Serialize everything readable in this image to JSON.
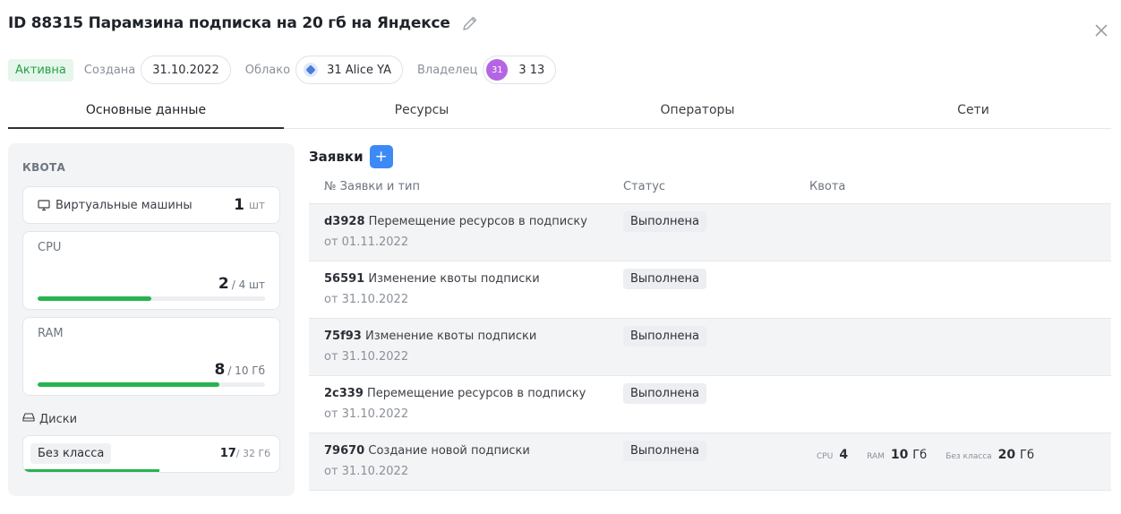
{
  "header": {
    "title": "ID 88315 Парамзина подписка на 20 гб на Яндексе",
    "edit_icon": "pencil-icon",
    "close_icon": "close-icon"
  },
  "meta": {
    "status": "Активна",
    "created_label": "Создана",
    "created_value": "31.10.2022",
    "cloud_label": "Облако",
    "cloud_value": "31 Alice YA",
    "owner_label": "Владелец",
    "owner_avatar": "31",
    "owner_value": "3 13"
  },
  "tabs": [
    {
      "label": "Основные данные",
      "active": true
    },
    {
      "label": "Ресурсы",
      "active": false
    },
    {
      "label": "Операторы",
      "active": false
    },
    {
      "label": "Сети",
      "active": false
    }
  ],
  "quota": {
    "title": "КВОТА",
    "vm": {
      "label": "Виртуальные машины",
      "value": "1",
      "unit": "шт",
      "icon": "monitor-icon"
    },
    "cpu": {
      "label": "CPU",
      "used": "2",
      "total": "/ 4 шт",
      "fraction": 0.5
    },
    "ram": {
      "label": "RAM",
      "used": "8",
      "total": "/ 10 Гб",
      "fraction": 0.8
    },
    "disks": {
      "label": "Диски",
      "icon": "hard-drive-icon",
      "class": "Без класса",
      "used": "17",
      "total": "/ 32 Гб",
      "fraction": 0.53
    }
  },
  "requests": {
    "title": "Заявки",
    "add_label": "+",
    "columns": [
      "№ Заявки и тип",
      "Статус",
      "Квота"
    ],
    "rows": [
      {
        "id": "d3928",
        "type": "Перемещение ресурсов в подписку",
        "date": "от 01.11.2022",
        "status": "Выполнена",
        "quota": null
      },
      {
        "id": "56591",
        "type": "Изменение квоты подписки",
        "date": "от 31.10.2022",
        "status": "Выполнена",
        "quota": null
      },
      {
        "id": "75f93",
        "type": "Изменение квоты подписки",
        "date": "от 31.10.2022",
        "status": "Выполнена",
        "quota": null
      },
      {
        "id": "2c339",
        "type": "Перемещение ресурсов в подписку",
        "date": "от 31.10.2022",
        "status": "Выполнена",
        "quota": null
      },
      {
        "id": "79670",
        "type": "Создание новой подписки",
        "date": "от 31.10.2022",
        "status": "Выполнена",
        "quota": {
          "cpu_label": "CPU",
          "cpu_value": "4",
          "ram_label": "RAM",
          "ram_value": "10",
          "ram_unit": "Гб",
          "disk_label": "Без класса",
          "disk_value": "20",
          "disk_unit": "Гб"
        }
      }
    ]
  },
  "colors": {
    "accent": "#3d8af7",
    "success": "#27b350",
    "active_badge": "#24a148"
  }
}
